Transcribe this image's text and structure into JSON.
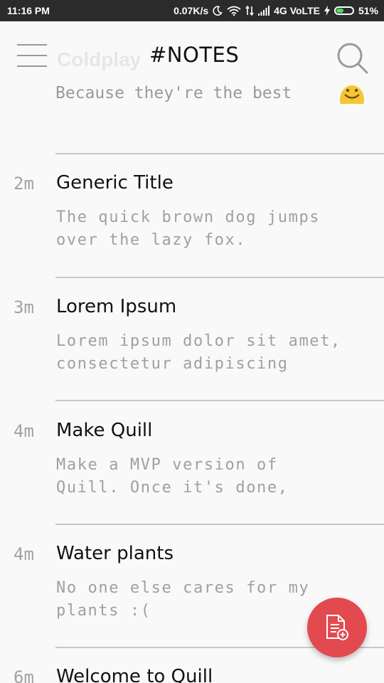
{
  "status_bar": {
    "time": "11:16 PM",
    "speed": "0.07K/s",
    "network": "4G VoLTE",
    "battery_percent": "51%",
    "battery_level": 0.51,
    "icons": [
      "moon-icon",
      "wifi-icon",
      "data-arrows-icon",
      "signal-icon",
      "charging-bolt-icon",
      "battery-icon"
    ]
  },
  "app_bar": {
    "title": "#NOTES",
    "menu_ghost_text": "Coldplay",
    "menu_icon": "hamburger-menu-icon",
    "search_icon": "search-icon"
  },
  "partial_note": {
    "preview": "Because they're the best",
    "emoji_icon": "smiley-emoji-icon"
  },
  "notes": [
    {
      "age": "2m",
      "title": "Generic Title",
      "preview": "The quick brown dog jumps\nover the lazy fox."
    },
    {
      "age": "3m",
      "title": "Lorem Ipsum",
      "preview": "Lorem ipsum dolor sit amet,\nconsectetur adipiscing"
    },
    {
      "age": "4m",
      "title": "Make Quill",
      "preview": "Make a MVP version of\nQuill. Once it's done,"
    },
    {
      "age": "4m",
      "title": "Water plants",
      "preview": "No one else cares for my\nplants :("
    },
    {
      "age": "6m",
      "title": "Welcome to Quill",
      "preview": ""
    }
  ],
  "fab": {
    "icon": "new-note-icon",
    "color": "#e34a4f"
  },
  "colors": {
    "background": "#f9f9f9",
    "status_bar": "#2b2b2b",
    "divider": "#c8c8c8",
    "text_muted": "#a0a0a0"
  }
}
